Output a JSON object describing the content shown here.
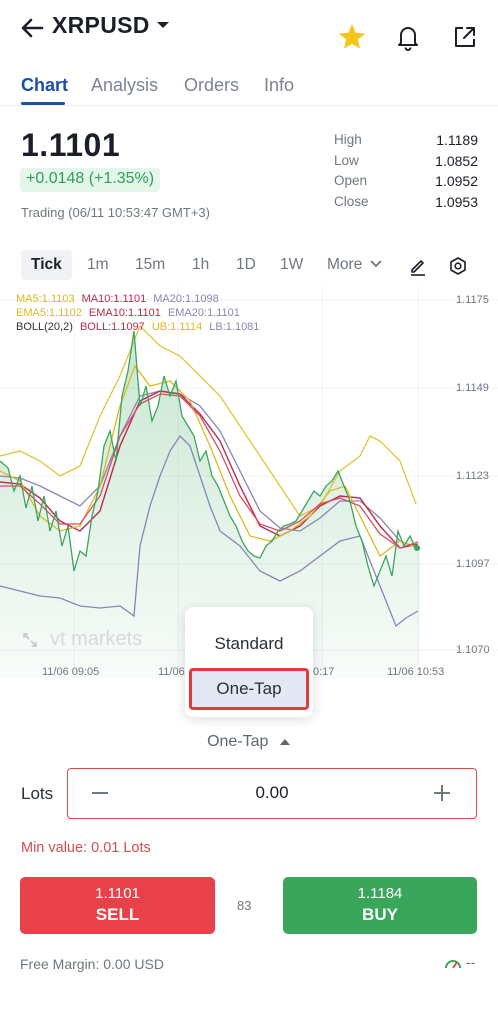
{
  "header": {
    "symbol": "XRPUSD",
    "icons": [
      "back-arrow-icon",
      "caret-down-icon",
      "star-icon",
      "bell-icon",
      "external-link-icon"
    ],
    "favorite_color": "#f5c518"
  },
  "tabs": [
    "Chart",
    "Analysis",
    "Orders",
    "Info"
  ],
  "active_tab": "Chart",
  "quote": {
    "price": "1.1101",
    "change": "+0.0148 (+1.35%)",
    "status": "Trading (06/11 10:53:47 GMT+3)"
  },
  "stats": [
    {
      "label": "High",
      "value": "1.1189"
    },
    {
      "label": "Low",
      "value": "1.0852"
    },
    {
      "label": "Open",
      "value": "1.0952"
    },
    {
      "label": "Close",
      "value": "1.0953"
    }
  ],
  "timeframes": [
    "Tick",
    "1m",
    "15m",
    "1h",
    "1D",
    "1W",
    "More"
  ],
  "active_timeframe": "Tick",
  "chart": {
    "legend": {
      "row1": [
        "MA5:1.1103",
        "MA10:1.1101",
        "MA20:1.1098"
      ],
      "row2": [
        "EMA5:1.1102",
        "EMA10:1.1101",
        "EMA20:1.1101"
      ],
      "row3": [
        "BOLL(20,2)",
        "BOLL:1.1097",
        "UB:1.1114",
        "LB:1.1081"
      ]
    },
    "y_ticks": [
      "1.1175",
      "1.1149",
      "1.1123",
      "1.1097",
      "1.1070"
    ],
    "x_ticks": [
      "11/06 09:05",
      "11/06",
      "0:17",
      "11/06 10:53"
    ],
    "watermark": "vt markets",
    "colors": {
      "ma5": "#e0b81e",
      "ma10": "#c0294a",
      "ma20": "#8a84b8",
      "ema5": "#e0b81e",
      "ema10": "#c0294a",
      "ema20": "#8a84b8",
      "boll": "#333333",
      "price": "#3aa65b"
    }
  },
  "execution": {
    "options": [
      "Standard",
      "One-Tap"
    ],
    "selected": "One-Tap",
    "current_label": "One-Tap"
  },
  "order": {
    "lots_label": "Lots",
    "lots_value": "0.00",
    "min_value": "Min value: 0.01 Lots",
    "sell_price": "1.1101",
    "sell_label": "SELL",
    "spread": "83",
    "buy_price": "1.1184",
    "buy_label": "BUY",
    "free_margin": "Free Margin: 0.00 USD",
    "margin_level": "--"
  }
}
